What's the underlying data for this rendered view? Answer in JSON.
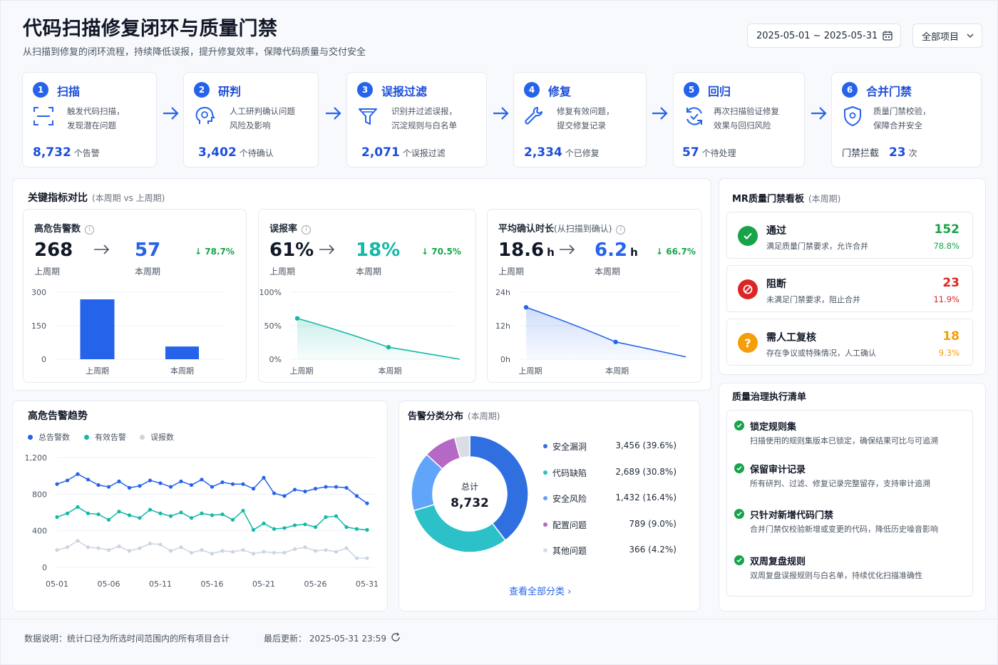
{
  "header": {
    "title": "代码扫描修复闭环与质量门禁",
    "subtitle": "从扫描到修复的闭环流程，持续降低误报，提升修复效率，保障代码质量与交付安全",
    "date_range": "2025-05-01 ~ 2025-05-31",
    "project_select": "全部项目"
  },
  "steps": [
    {
      "num": "1",
      "name": "扫描",
      "desc1": "触发代码扫描，",
      "desc2": "发现潜在问题",
      "value": "8,732",
      "unit": "个告警",
      "icon": "scan-icon"
    },
    {
      "num": "2",
      "name": "研判",
      "desc1": "人工研判确认问题",
      "desc2": "风险及影响",
      "value": "3,402",
      "unit": "个待确认",
      "icon": "brain-icon"
    },
    {
      "num": "3",
      "name": "误报过滤",
      "desc1": "识别并过滤误报，",
      "desc2": "沉淀规则与白名单",
      "value": "2,071",
      "unit": "个误报过滤",
      "icon": "filter-icon"
    },
    {
      "num": "4",
      "name": "修复",
      "desc1": "修复有效问题，",
      "desc2": "提交修复记录",
      "value": "2,334",
      "unit": "个已修复",
      "icon": "wrench-icon"
    },
    {
      "num": "5",
      "name": "回归",
      "desc1": "再次扫描验证修复",
      "desc2": "效果与回归风险",
      "value": "57",
      "unit": "个待处理",
      "icon": "refresh-check-icon"
    },
    {
      "num": "6",
      "name": "合并门禁",
      "desc1": "质量门禁校验，",
      "desc2": "保障合并安全",
      "prefix": "门禁拦截",
      "value": "23",
      "unit": "次",
      "icon": "shield-icon"
    }
  ],
  "kpi_section": {
    "title": "关键指标对比",
    "subtitle": "(本周期 vs 上周期)"
  },
  "kpis": [
    {
      "name": "高危告警数",
      "qualifier": "",
      "prev": "268",
      "prev_unit": "",
      "cur": "57",
      "cur_unit": "",
      "prev_label": "上周期",
      "cur_label": "本周期",
      "delta": "↓ 78.7%",
      "color": "#2563eb",
      "delta_color": "#16a34a"
    },
    {
      "name": "误报率",
      "qualifier": "",
      "prev": "61%",
      "prev_unit": "",
      "cur": "18%",
      "cur_unit": "",
      "prev_label": "上周期",
      "cur_label": "本周期",
      "delta": "↓ 70.5%",
      "color": "#14b8a6",
      "delta_color": "#16a34a"
    },
    {
      "name": "平均确认时长",
      "qualifier": "(从扫描到确认)",
      "prev": "18.6",
      "prev_unit": "h",
      "cur": "6.2",
      "cur_unit": "h",
      "prev_label": "上周期",
      "cur_label": "本周期",
      "delta": "↓ 66.7%",
      "color": "#2563eb",
      "delta_color": "#16a34a"
    }
  ],
  "chart_data": [
    {
      "type": "bar",
      "categories": [
        "上周期",
        "本周期"
      ],
      "values": [
        268,
        57
      ],
      "ylim": [
        0,
        300
      ],
      "yticks": [
        "0",
        "150",
        "300"
      ],
      "color": "#2563eb"
    },
    {
      "type": "area",
      "categories": [
        "上周期",
        "本周期"
      ],
      "values": [
        61,
        18
      ],
      "ylim": [
        0,
        100
      ],
      "yticks": [
        "0%",
        "50%",
        "100%"
      ],
      "color": "#14b8a6"
    },
    {
      "type": "area",
      "categories": [
        "上周期",
        "本周期"
      ],
      "values": [
        18.6,
        6.2
      ],
      "ylim": [
        0,
        24
      ],
      "yticks": [
        "0h",
        "12h",
        "24h"
      ],
      "color": "#2563eb"
    },
    {
      "type": "line",
      "title": "高危告警趋势",
      "x_ticks": [
        "05-01",
        "05-06",
        "05-11",
        "05-16",
        "05-21",
        "05-26",
        "05-31"
      ],
      "yticks": [
        "0",
        "400",
        "800",
        "1,200"
      ],
      "ylim": [
        0,
        1200
      ],
      "series": [
        {
          "name": "总告警数",
          "color": "#2563eb",
          "values": [
            910,
            950,
            1020,
            960,
            900,
            880,
            940,
            870,
            890,
            950,
            920,
            880,
            940,
            900,
            960,
            880,
            930,
            910,
            910,
            860,
            980,
            810,
            780,
            850,
            830,
            860,
            880,
            880,
            870,
            780,
            700
          ]
        },
        {
          "name": "有效告警",
          "color": "#14b8a6",
          "values": [
            550,
            590,
            660,
            590,
            580,
            520,
            610,
            570,
            540,
            630,
            590,
            560,
            600,
            540,
            590,
            570,
            580,
            520,
            620,
            410,
            480,
            420,
            430,
            460,
            470,
            440,
            550,
            560,
            440,
            420,
            410
          ]
        },
        {
          "name": "误报数",
          "color": "#cbd5e1",
          "values": [
            190,
            220,
            290,
            220,
            210,
            190,
            230,
            180,
            210,
            260,
            250,
            180,
            220,
            160,
            190,
            150,
            180,
            170,
            190,
            150,
            170,
            160,
            160,
            200,
            220,
            180,
            190,
            170,
            210,
            100,
            100
          ]
        }
      ]
    },
    {
      "type": "pie",
      "title": "告警分类分布",
      "center_label": "总计",
      "center_value": "8,732",
      "categories": [
        "安全漏洞",
        "代码缺陷",
        "安全风险",
        "配置问题",
        "其他问题"
      ],
      "values": [
        3456,
        2689,
        1432,
        789,
        366
      ],
      "value_labels": [
        "3,456",
        "2,689",
        "1,432",
        "789",
        "366"
      ],
      "percents": [
        "(39.6%)",
        "(30.8%)",
        "(16.4%)",
        "(9.0%)",
        "(4.2%)"
      ],
      "colors": [
        "#2f6fe0",
        "#2cc0c8",
        "#60a5fa",
        "#b568c4",
        "#d9dde5"
      ]
    }
  ],
  "trend": {
    "title": "高危告警趋势",
    "legend": [
      "总告警数",
      "有效告警",
      "误报数"
    ],
    "legend_colors": [
      "#2563eb",
      "#14b8a6",
      "#cbd5e1"
    ]
  },
  "distribution": {
    "title": "告警分类分布",
    "subtitle": "(本周期)",
    "link": "查看全部分类 ›"
  },
  "gate_board": {
    "title": "MR质量门禁看板",
    "subtitle": "(本周期)",
    "rows": [
      {
        "name": "通过",
        "desc": "满足质量门禁要求，允许合并",
        "count": "152",
        "pct": "78.8%",
        "color": "#16a34a",
        "icon": "check-circle-icon"
      },
      {
        "name": "阻断",
        "desc": "未满足门禁要求，阻止合并",
        "count": "23",
        "pct": "11.9%",
        "color": "#dc2626",
        "icon": "block-icon"
      },
      {
        "name": "需人工复核",
        "desc": "存在争议或特殊情况，人工确认",
        "count": "18",
        "pct": "9.3%",
        "color": "#f59e0b",
        "icon": "question-icon"
      }
    ]
  },
  "checklist": {
    "title": "质量治理执行清单",
    "items": [
      {
        "title": "锁定规则集",
        "desc": "扫描使用的规则集版本已锁定，确保结果可比与可追溯"
      },
      {
        "title": "保留审计记录",
        "desc": "所有研判、过滤、修复记录完整留存，支持审计追溯"
      },
      {
        "title": "只针对新增代码门禁",
        "desc": "合并门禁仅校验新增或变更的代码，降低历史噪音影响"
      },
      {
        "title": "双周复盘规则",
        "desc": "双周复盘误报规则与白名单，持续优化扫描准确性"
      }
    ]
  },
  "footer": {
    "note": "数据说明：统计口径为所选时间范围内的所有项目合计",
    "updated_label": "最后更新：",
    "updated_value": "2025-05-31 23:59"
  }
}
